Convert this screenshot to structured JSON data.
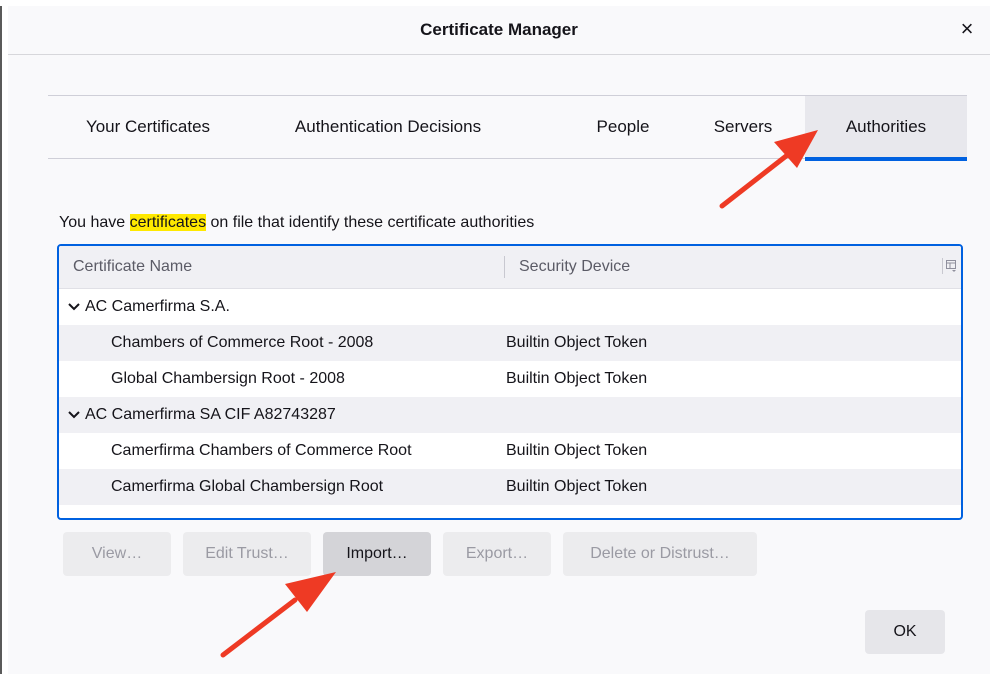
{
  "dialog": {
    "title": "Certificate Manager",
    "close_glyph": "×"
  },
  "tabs": [
    {
      "label": "Your Certificates",
      "selected": false
    },
    {
      "label": "Authentication Decisions",
      "selected": false
    },
    {
      "label": "People",
      "selected": false
    },
    {
      "label": "Servers",
      "selected": false
    },
    {
      "label": "Authorities",
      "selected": true
    }
  ],
  "description": {
    "before": "You have ",
    "highlight": "certificates",
    "after": " on file that identify these certificate authorities"
  },
  "table": {
    "columns": [
      "Certificate Name",
      "Security Device"
    ],
    "rows": [
      {
        "type": "group",
        "name": "AC Camerfirma S.A.",
        "device": ""
      },
      {
        "type": "item",
        "name": "Chambers of Commerce Root - 2008",
        "device": "Builtin Object Token"
      },
      {
        "type": "item",
        "name": "Global Chambersign Root - 2008",
        "device": "Builtin Object Token"
      },
      {
        "type": "group",
        "name": "AC Camerfirma SA CIF A82743287",
        "device": ""
      },
      {
        "type": "item",
        "name": "Camerfirma Chambers of Commerce Root",
        "device": "Builtin Object Token"
      },
      {
        "type": "item",
        "name": "Camerfirma Global Chambersign Root",
        "device": "Builtin Object Token"
      }
    ]
  },
  "buttons": {
    "view": "View…",
    "edit_trust": "Edit Trust…",
    "import": "Import…",
    "export": "Export…",
    "delete": "Delete or Distrust…",
    "ok": "OK"
  },
  "colors": {
    "accent": "#0061e0",
    "highlight": "#ffe900",
    "annotation_arrow": "#ee3a24"
  },
  "icons": [
    "close-icon",
    "chevron-down-icon",
    "column-picker-icon",
    "red-arrow-annotation"
  ]
}
